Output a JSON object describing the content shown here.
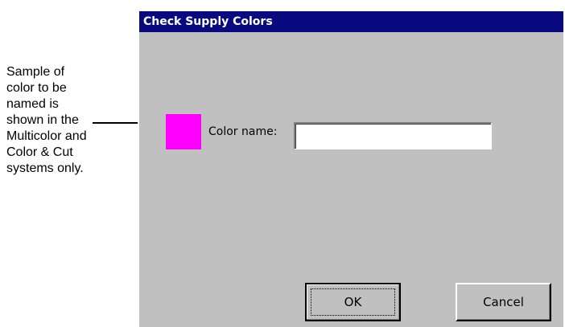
{
  "annotation": {
    "text": "Sample of\ncolor to be\nnamed is\nshown in the\nMulticolor and\nColor & Cut\nsystems only."
  },
  "dialog": {
    "title": "Check Supply Colors",
    "swatch_color": "#ff00ff",
    "color_name_label": "Color name:",
    "color_name_value": "",
    "ok_label": "OK",
    "cancel_label": "Cancel"
  },
  "colors": {
    "title_bar": "#0a0a80",
    "dialog_bg": "#c0c0c0"
  }
}
